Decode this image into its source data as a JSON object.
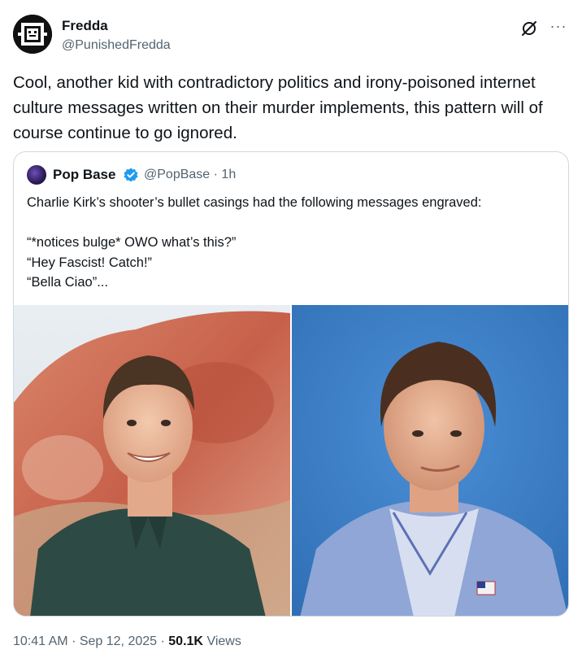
{
  "author": {
    "name": "Fredda",
    "handle": "@PunishedFredda",
    "avatar_icon": "pixel-face-avatar"
  },
  "tweet": {
    "text": "Cool, another kid with contradictory politics and irony-poisoned internet culture messages written on their murder implements, this pattern will of course continue to go ignored."
  },
  "header_icons": [
    "grok-icon",
    "more-icon"
  ],
  "quote": {
    "name": "Pop Base",
    "handle": "@PopBase",
    "separator": "·",
    "time": "1h",
    "verified": true,
    "verified_color": "#1d9bf0",
    "text": "Charlie Kirk’s shooter’s bullet casings had the following messages engraved:\n\n“*notices bulge* OWO what’s this?”\n“Hey Fascist! Catch!”\n“Bella Ciao”...",
    "media": [
      {
        "icon": "photo-young-man-outdoor-red-rocks"
      },
      {
        "icon": "photo-man-blue-blazer-blue-background"
      }
    ]
  },
  "footer": {
    "time": "10:41 AM",
    "sep1": "·",
    "date": "Sep 12, 2025",
    "sep2": "·",
    "views_count": "50.1K",
    "views_label": "Views"
  },
  "colors": {
    "text_primary": "#0f1419",
    "text_secondary": "#536471",
    "border": "#cfd9de",
    "accent": "#1d9bf0"
  }
}
